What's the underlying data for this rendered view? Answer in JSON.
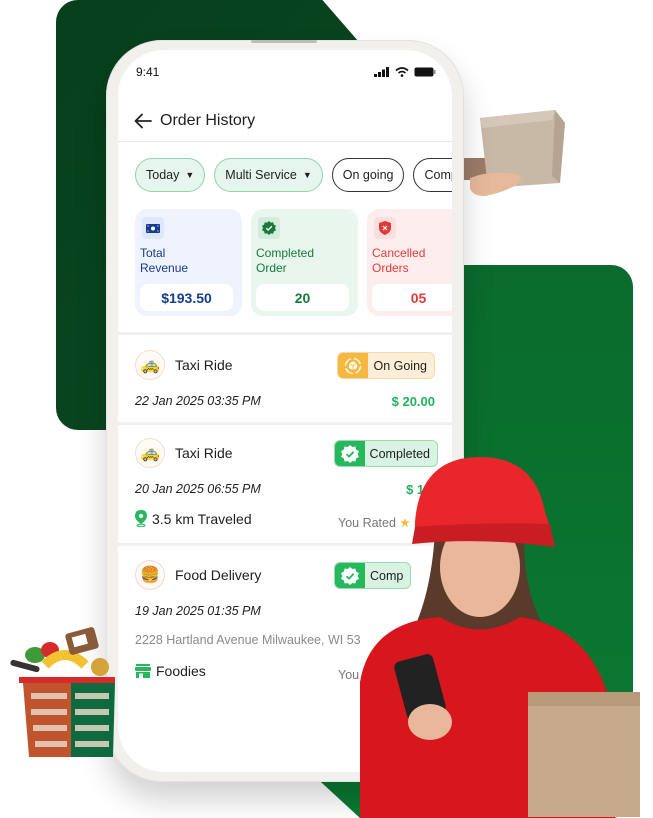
{
  "status_bar": {
    "time": "9:41"
  },
  "header": {
    "title": "Order History",
    "back_icon": "arrow-left-icon"
  },
  "filters": [
    {
      "label": "Today",
      "active": true,
      "has_dropdown": true
    },
    {
      "label": "Multi Service",
      "active": true,
      "has_dropdown": true
    },
    {
      "label": "On going",
      "active": false,
      "has_dropdown": false
    },
    {
      "label": "Comple",
      "active": false,
      "has_dropdown": false
    }
  ],
  "stats": [
    {
      "label_line1": "Total",
      "label_line2": "Revenue",
      "value": "$193.50",
      "icon": "cash-icon",
      "color": "#163b8f"
    },
    {
      "label_line1": "Completed",
      "label_line2": "Order",
      "value": "20",
      "icon": "verified-badge-icon",
      "color": "#167a3a"
    },
    {
      "label_line1": "Cancelled",
      "label_line2": "Orders",
      "value": "05",
      "icon": "shield-x-icon",
      "color": "#e03a3a"
    }
  ],
  "orders": [
    {
      "service": "Taxi Ride",
      "icon": "taxi-icon",
      "status": "On Going",
      "date": "22 Jan 2025  03:35 PM",
      "price": "$ 20.00"
    },
    {
      "service": "Taxi Ride",
      "icon": "taxi-icon",
      "status": "Completed",
      "date": "20 Jan  2025  06:55 PM",
      "price": "$ 14.",
      "distance": "3.5 km Traveled",
      "rated_label": "You Rated"
    },
    {
      "service": "Food Delivery",
      "icon": "burger-icon",
      "status": "Comp",
      "date": "19 Jan  2025  01:35 PM",
      "address": "2228 Hartland Avenue Milwaukee, WI 53",
      "store": "Foodies",
      "rated_label": "You"
    }
  ],
  "colors": {
    "brand_green": "#0a6b2d",
    "dark_green": "#063f1c",
    "price_green": "#22b15a",
    "ongoing_orange": "#f7b841",
    "completed_green": "#25b95c"
  }
}
